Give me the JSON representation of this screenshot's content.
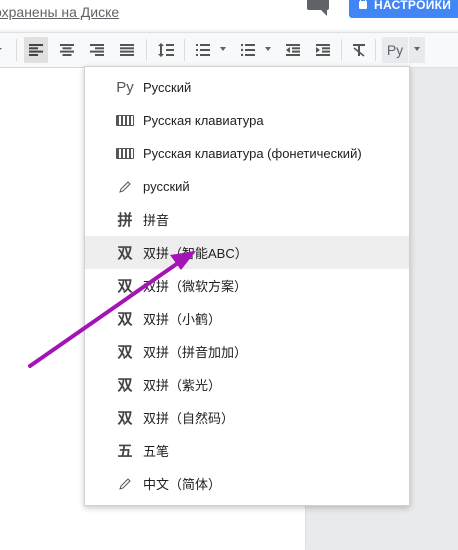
{
  "header": {
    "saved_text": "охранены на Диске",
    "settings_label": "НАСТРОЙКИ"
  },
  "toolbar": {
    "language_button": "Ру",
    "icons": [
      "align-left-icon",
      "align-center-icon",
      "align-right-icon",
      "align-justify-icon",
      "line-spacing-icon",
      "numbered-list-icon",
      "bulleted-list-icon",
      "decrease-indent-icon",
      "increase-indent-icon",
      "clear-formatting-icon"
    ]
  },
  "language_menu": {
    "hovered_index": 5,
    "items": [
      {
        "icon": "Ру",
        "label": "Русский"
      },
      {
        "icon": "keyboard-icon",
        "label": "Русская клавиатура"
      },
      {
        "icon": "keyboard-icon",
        "label": "Русская клавиатура (фонетический)"
      },
      {
        "icon": "pencil-icon",
        "label": "русский"
      },
      {
        "icon": "拼",
        "label": "拼音"
      },
      {
        "icon": "双",
        "label": "双拼（智能ABC）"
      },
      {
        "icon": "双",
        "label": "双拼（微软方案）"
      },
      {
        "icon": "双",
        "label": "双拼（小鹤）"
      },
      {
        "icon": "双",
        "label": "双拼（拼音加加）"
      },
      {
        "icon": "双",
        "label": "双拼（紫光）"
      },
      {
        "icon": "双",
        "label": "双拼（自然码）"
      },
      {
        "icon": "五",
        "label": "五笔"
      },
      {
        "icon": "pencil-icon",
        "label": "中文（简体）"
      }
    ]
  },
  "annotation": {
    "arrow_color": "#a313b5"
  },
  "colors": {
    "accent": "#4285f4",
    "hover": "#eeeeee"
  }
}
